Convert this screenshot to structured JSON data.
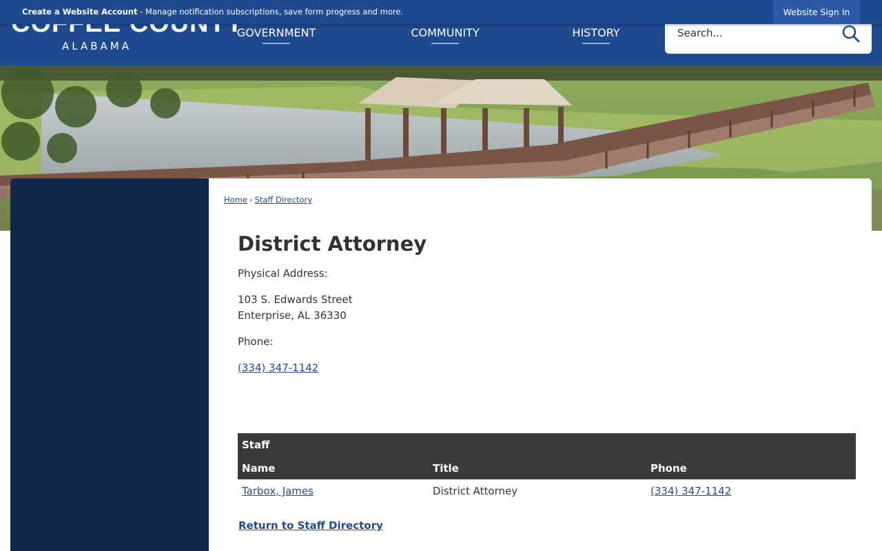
{
  "topbar": {
    "account_link": "Create a Website Account",
    "account_desc": " - Manage notification subscriptions, save form progress and more.",
    "sign_in": "Website Sign In"
  },
  "header": {
    "logo_name": "COFFEE COUNTY",
    "logo_sub": "ALABAMA",
    "nav": [
      "GOVERNMENT",
      "COMMUNITY",
      "HISTORY"
    ],
    "search_placeholder": "Search..."
  },
  "breadcrumb": [
    "Home",
    "Staff Directory"
  ],
  "page": {
    "title": "District Attorney",
    "physical_label": "Physical Address:",
    "address_line1": "103 S. Edwards Street",
    "address_line2": "Enterprise, AL 36330",
    "phone_label": "Phone:",
    "phone": "(334) 347-1142"
  },
  "staff": {
    "caption": "Staff",
    "headers": [
      "Name",
      "Title",
      "Phone"
    ],
    "rows": [
      {
        "name": "Tarbox, James",
        "title": "District Attorney",
        "phone": "(334) 347-1142"
      }
    ]
  },
  "return_link": "Return to Staff Directory",
  "colors": {
    "brand_blue": "#1f4a8f",
    "sidebar_navy": "#11284c",
    "table_header": "#3a3a3a"
  },
  "icons": {
    "search": "search-icon"
  }
}
